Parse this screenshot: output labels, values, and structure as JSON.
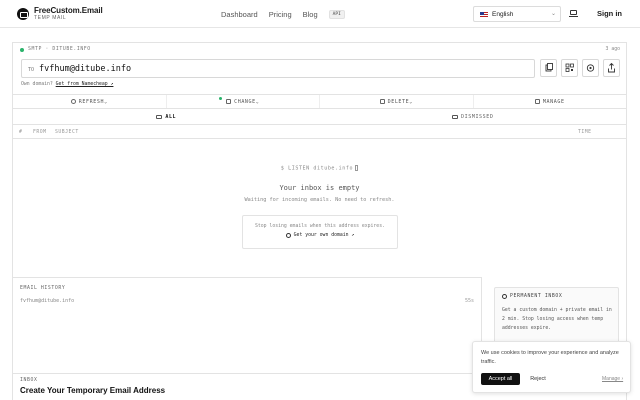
{
  "nav": {
    "brand_title": "FreeCustom.Email",
    "brand_sub": "TEMP MAIL",
    "links": [
      "Dashboard",
      "Pricing",
      "Blog"
    ],
    "api_badge": "API",
    "language": "English",
    "signin": "Sign in"
  },
  "mailbox": {
    "smtp_status": "SMTP · DITUBE.INFO",
    "updated_ago": "3 ago",
    "to_label": "TO",
    "address": "fvfhum@ditube.info",
    "own_domain_prefix": "Own domain?",
    "own_domain_link": "Get from Namecheap ↗",
    "icon_buttons": [
      "copy-icon",
      "qr-code-icon",
      "settings-icon",
      "share-icon"
    ]
  },
  "actions": {
    "refresh": "REFRESH",
    "change": "CHANGE",
    "delete": "DELETE",
    "manage": "MANAGE"
  },
  "tabs": {
    "all": "ALL",
    "dismissed": "DISMISSED"
  },
  "table": {
    "col_num": "#",
    "col_from": "FROM",
    "col_subject": "SUBJECT",
    "col_time": "TIME"
  },
  "empty": {
    "listen": "$ LISTEN ditube.info",
    "title": "Your inbox is empty",
    "subtitle": "Waiting for incoming emails. No need to refresh.",
    "promo_text": "Stop losing emails when this address expires.",
    "promo_link": "Get your own domain ↗"
  },
  "history": {
    "label": "EMAIL HISTORY",
    "address": "fvfhum@ditube.info",
    "ago": "55s"
  },
  "permanent": {
    "title": "PERMANENT INBOX",
    "body": "Get a custom domain + private email in 2 min. Stop losing access when temp addresses expire."
  },
  "inbox_section": {
    "label": "INBOX",
    "title": "Create Your Temporary Email Address"
  },
  "cookie": {
    "text": "We use cookies to improve your experience and analyze traffic.",
    "accept": "Accept all",
    "reject": "Reject",
    "manage": "Manage ›"
  },
  "colors": {
    "status_green": "#2bb36b",
    "primary": "#111111"
  }
}
